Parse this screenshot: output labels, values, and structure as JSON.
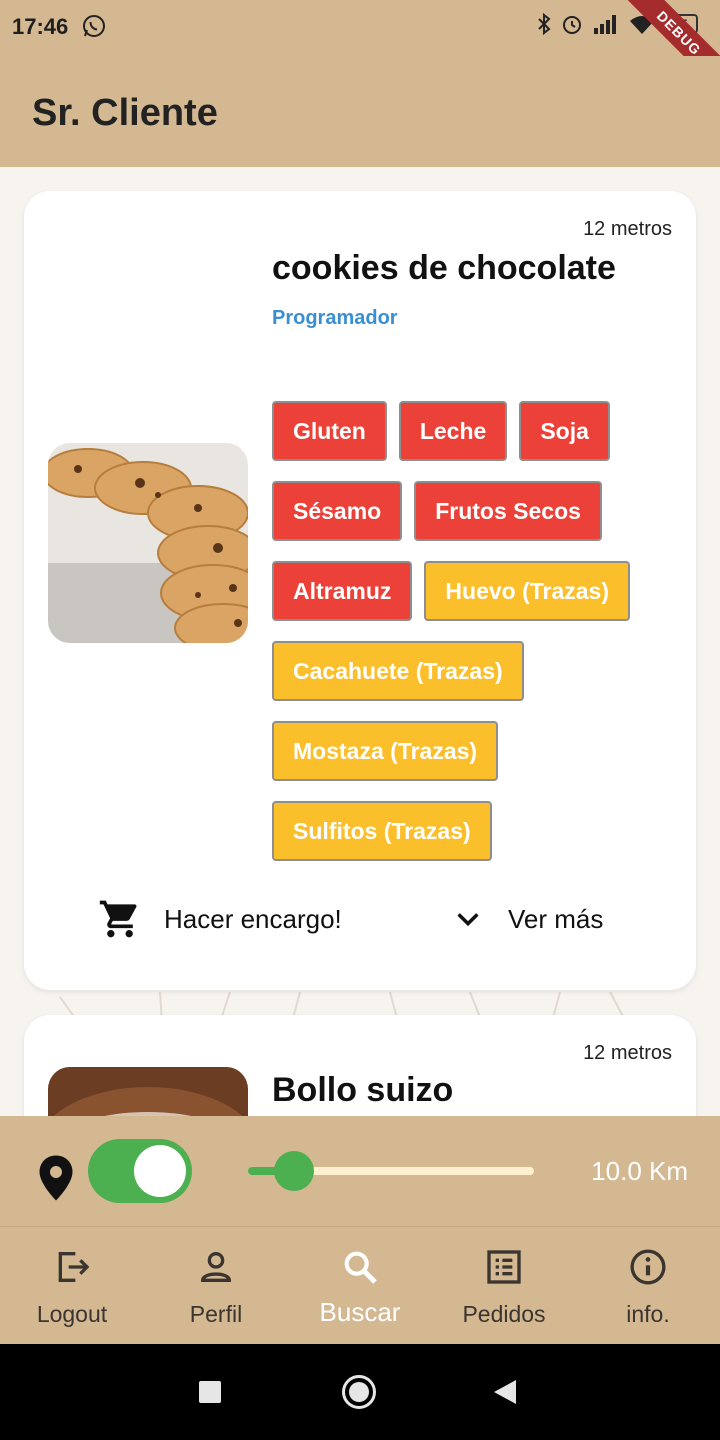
{
  "status_bar": {
    "time": "17:46",
    "battery": "35"
  },
  "debug_banner": "DEBUG",
  "app_bar": {
    "title": "Sr. Cliente"
  },
  "products": [
    {
      "distance": "12 metros",
      "title": "cookies de chocolate",
      "seller": "Programador",
      "image": "cookies-photo",
      "allergens": [
        [
          "Gluten",
          "Leche",
          "Soja"
        ],
        [
          "Sésamo",
          "Frutos Secos"
        ],
        [
          "Altramuz",
          "Huevo (Trazas)"
        ],
        [
          "Cacahuete (Trazas)"
        ],
        [
          "Mostaza (Trazas)"
        ],
        [
          "Sulfitos (Trazas)"
        ]
      ],
      "order_label": "Hacer encargo!",
      "more_label": "Ver más"
    },
    {
      "distance": "12 metros",
      "title": "Bollo suizo",
      "image": "bollo-photo"
    }
  ],
  "filter": {
    "location_enabled": true,
    "distance_fraction": 0.16,
    "distance_label": "10.0 Km"
  },
  "bottom_nav": [
    {
      "label": "Logout",
      "icon": "logout-icon"
    },
    {
      "label": "Perfil",
      "icon": "person-icon"
    },
    {
      "label": "Buscar",
      "icon": "search-icon",
      "active": true
    },
    {
      "label": "Pedidos",
      "icon": "list-icon"
    },
    {
      "label": "info.",
      "icon": "info-icon"
    }
  ],
  "colors": {
    "primary": "#d4b891",
    "allergen_red": "#eb4138",
    "allergen_yellow": "#fbbf2c",
    "toggle_green": "#4caf50",
    "seller_blue": "#3a8fd4"
  }
}
